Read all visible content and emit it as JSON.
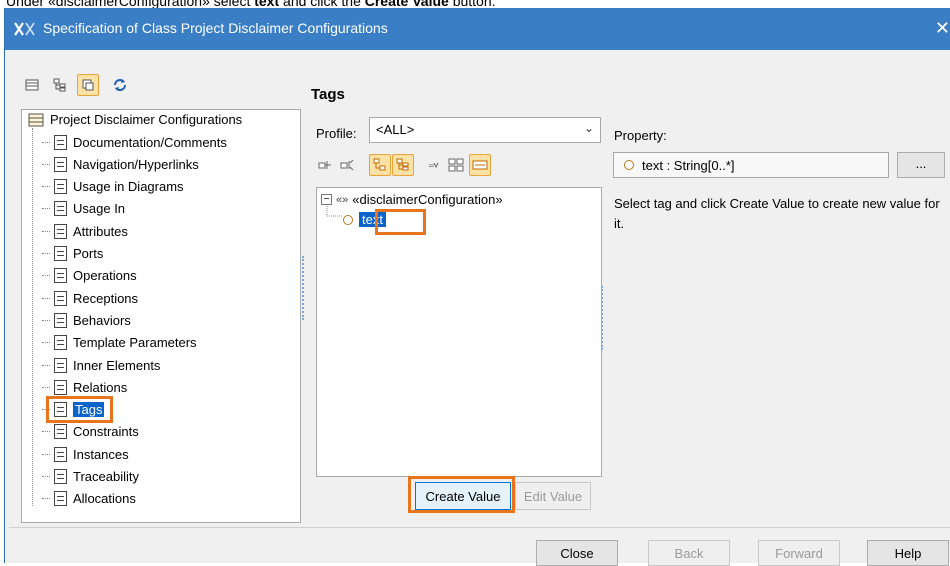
{
  "instruction": {
    "prefix": "Under «disclaimerConfiguration» select ",
    "bold1": "text",
    "middle": " and click the ",
    "bold2": "Create Value",
    "suffix": " button."
  },
  "window": {
    "title": "Specification of Class Project Disclaimer Configurations",
    "close_glyph": "✕"
  },
  "left_toolbar": [
    {
      "icon": "table-icon",
      "active": false
    },
    {
      "icon": "tree-icon",
      "active": false
    },
    {
      "icon": "copy-icon",
      "active": true
    },
    {
      "icon": "refresh-icon",
      "active": false
    }
  ],
  "tree": {
    "root_label": "Project Disclaimer Configurations",
    "items": [
      "Documentation/Comments",
      "Navigation/Hyperlinks",
      "Usage in Diagrams",
      "Usage In",
      "Attributes",
      "Ports",
      "Operations",
      "Receptions",
      "Behaviors",
      "Template Parameters",
      "Inner Elements",
      "Relations",
      "Tags",
      "Constraints",
      "Instances",
      "Traceability",
      "Allocations"
    ],
    "selected": "Tags"
  },
  "tags_panel": {
    "title": "Tags",
    "profile_label": "Profile:",
    "profile_value": "<ALL>",
    "stereotype_label": "«disclaimerConfiguration»",
    "stereotype_glyph": "«»",
    "tag_label": "text",
    "create_value": "Create Value",
    "edit_value": "Edit Value"
  },
  "property": {
    "label": "Property:",
    "value": "text : String[0..*]",
    "browse": "...",
    "description": "Select tag and click Create Value to create new value for it."
  },
  "footer": {
    "close": "Close",
    "back": "Back",
    "forward": "Forward",
    "help": "Help"
  },
  "colors": {
    "titlebar": "#3a7ec6",
    "selection": "#0a64c9",
    "highlight": "#e8741e"
  }
}
